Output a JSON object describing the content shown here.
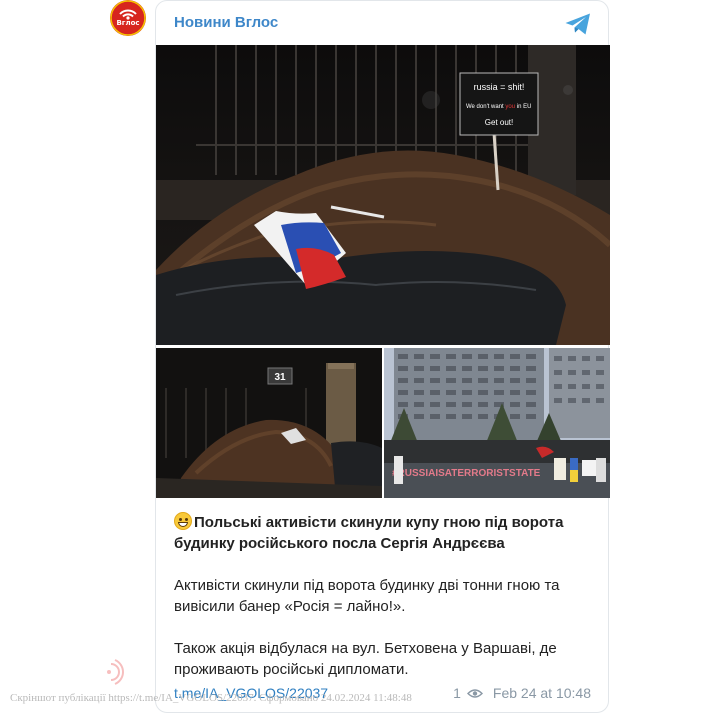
{
  "channel": {
    "name": "Новини Вглос",
    "avatar_text": "Вглос",
    "brand_color": "#d7261e",
    "accent_color": "#3e87c9",
    "icon": "telegram-icon"
  },
  "photos": {
    "main": {
      "sign_line1": "russia = shit!",
      "sign_line2_a": "We don't want",
      "sign_line2_b": "you",
      "sign_line2_c": "in EU",
      "sign_line3": "Get out!"
    },
    "left": {
      "house_number": "31"
    },
    "right": {
      "banner_text": "#RUSSIAISATERRORISTSTATE"
    }
  },
  "post": {
    "emoji": "grinning-face-emoji",
    "title": "Польські активісти скинули купу гною під ворота будинку російського посла Сергія Андрєєва",
    "paragraph1": "Активісти скинули під ворота будинку дві тонни гною та вивісили банер «Росія = лайно!».",
    "paragraph2": "Також акція відбулася на вул. Бетховена у Варшаві, де проживають російські дипломати.",
    "link": "t.me/IA_VGOLOS/22037",
    "views": "1",
    "date": "Feb 24 at 10:48"
  },
  "footer_note": "Скріншот публікації https://t.me/IA_VGOLOS/22037. Сформовано 24.02.2024 11:48:48"
}
